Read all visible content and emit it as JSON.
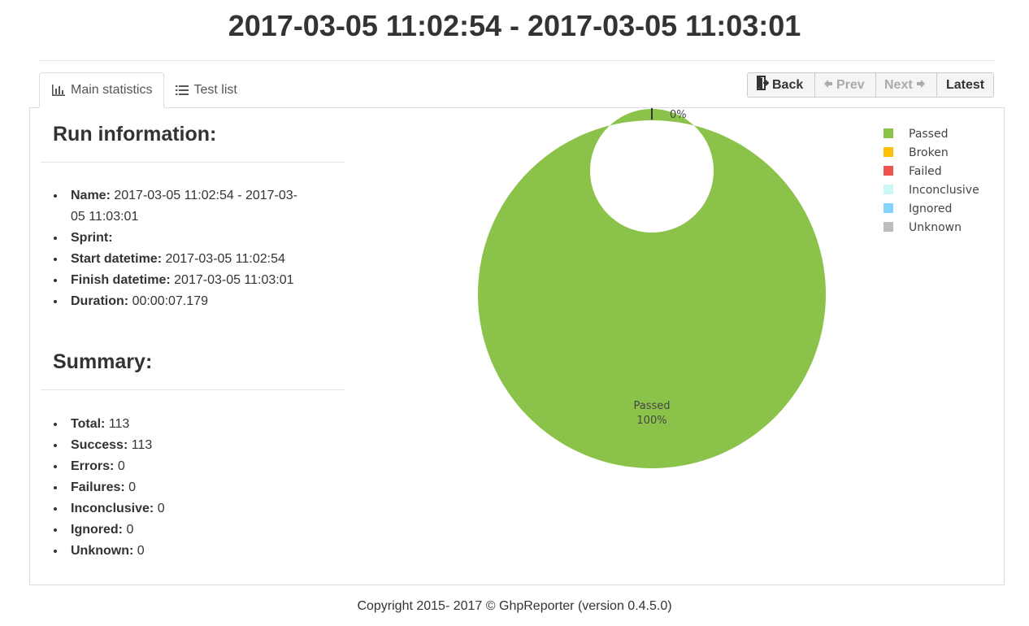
{
  "header": {
    "title": "2017-03-05 11:02:54 - 2017-03-05 11:03:01"
  },
  "tabs": [
    {
      "label": "Main statistics",
      "icon": "bar-chart-icon",
      "active": true
    },
    {
      "label": "Test list",
      "icon": "list-icon",
      "active": false
    }
  ],
  "nav": {
    "back_label": "Back",
    "prev_label": "Prev",
    "next_label": "Next",
    "latest_label": "Latest"
  },
  "run_info": {
    "title": "Run information:",
    "name_key": "Name:",
    "name_val_line1": "2017-03-05 11:02:54 - 2017-03-",
    "name_val_line2": "05 11:03:01",
    "sprint_key": "Sprint:",
    "sprint_val": "",
    "start_key": "Start datetime:",
    "start_val": "2017-03-05 11:02:54",
    "finish_key": "Finish datetime:",
    "finish_val": "2017-03-05 11:03:01",
    "duration_key": "Duration:",
    "duration_val": "00:00:07.179"
  },
  "summary": {
    "title": "Summary:",
    "items": [
      {
        "key": "Total:",
        "value": "113"
      },
      {
        "key": "Success:",
        "value": "113"
      },
      {
        "key": "Errors:",
        "value": "0"
      },
      {
        "key": "Failures:",
        "value": "0"
      },
      {
        "key": "Inconclusive:",
        "value": "0"
      },
      {
        "key": "Ignored:",
        "value": "0"
      },
      {
        "key": "Unknown:",
        "value": "0"
      }
    ]
  },
  "chart_data": {
    "type": "pie",
    "title": "",
    "categories": [
      "Passed",
      "Broken",
      "Failed",
      "Inconclusive",
      "Ignored",
      "Unknown"
    ],
    "values": [
      113,
      0,
      0,
      0,
      0,
      0
    ],
    "colors": [
      "#8bc34a",
      "#ffc107",
      "#ef5350",
      "#ccf7f7",
      "#81d4fa",
      "#bdbdbd"
    ],
    "inner_label": {
      "name": "Passed",
      "percent": "100%"
    },
    "outer_label": "0%",
    "legend_position": "top-right"
  },
  "footer": {
    "text": "Copyright 2015- 2017 © GhpReporter (version 0.4.5.0)"
  }
}
